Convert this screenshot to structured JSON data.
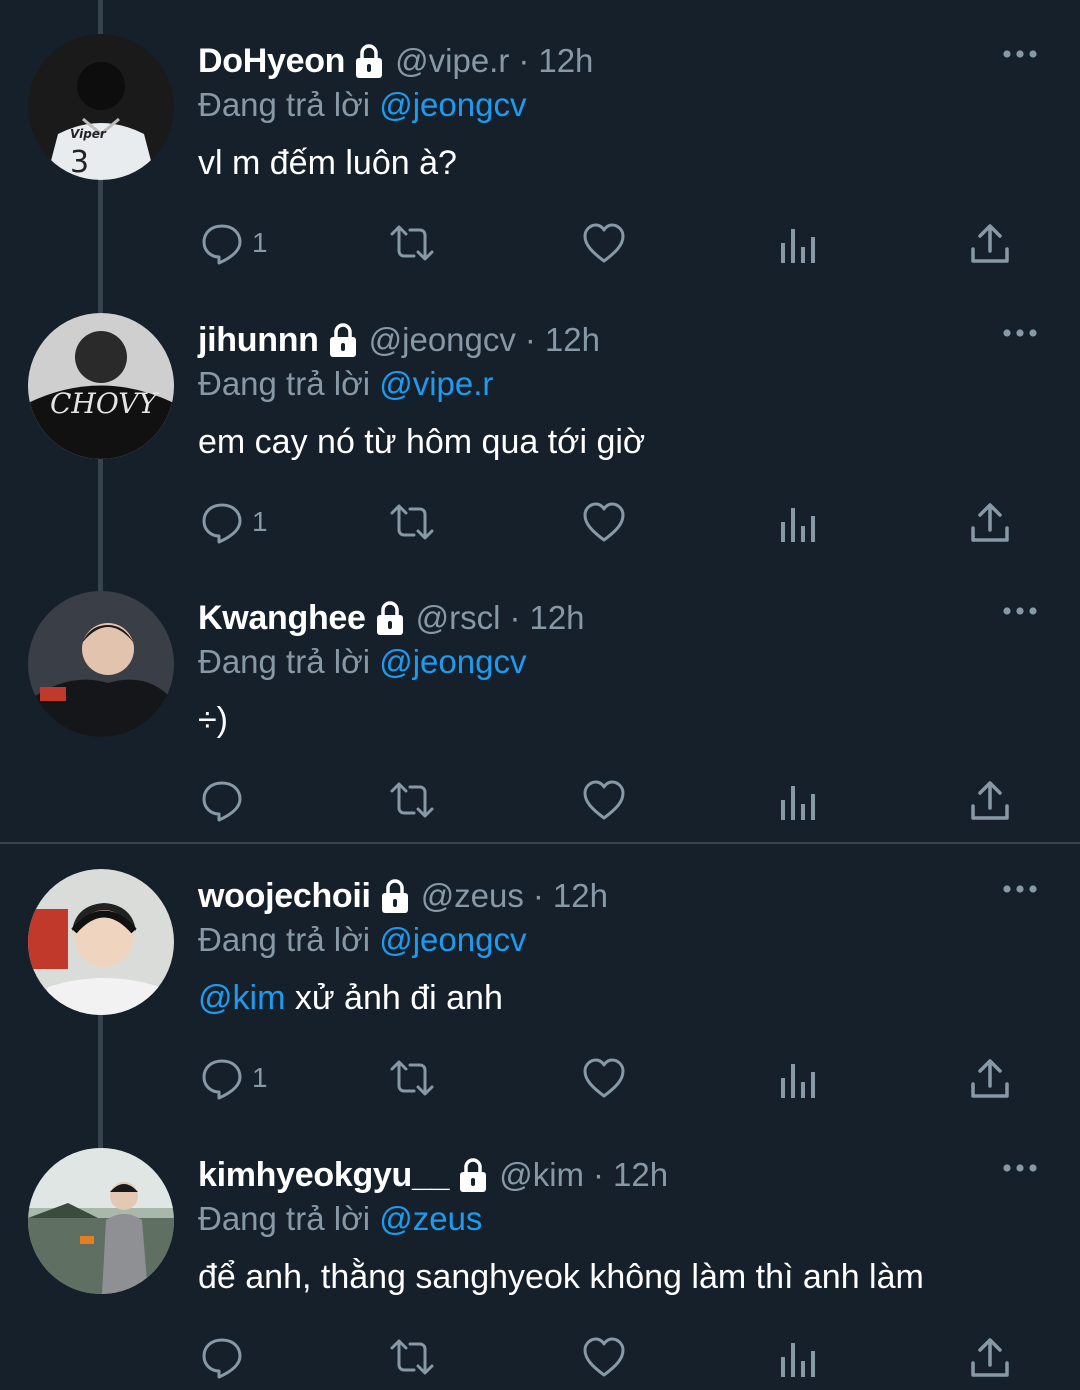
{
  "theme": {
    "background": "#15202b",
    "text": "#ffffff",
    "muted": "#8899a6",
    "accent": "#1d9bf0",
    "line": "#38444d"
  },
  "replying_prefix": "Đang trả lời",
  "tweets": [
    {
      "name": "DoHyeon",
      "handle": "@vipe.r",
      "time": "12h",
      "replying_to": "@jeongcv",
      "mention": "",
      "text": "vl m đếm luôn à?",
      "reply_count": "1",
      "avatar_text": "Viper"
    },
    {
      "name": "jihunnn",
      "handle": "@jeongcv",
      "time": "12h",
      "replying_to": "@vipe.r",
      "mention": "",
      "text": "em cay nó từ hôm qua tới giờ",
      "reply_count": "1",
      "avatar_text": "CHOVY"
    },
    {
      "name": "Kwanghee",
      "handle": "@rscl",
      "time": "12h",
      "replying_to": "@jeongcv",
      "mention": "",
      "text": "÷)",
      "reply_count": "",
      "avatar_text": ""
    },
    {
      "name": "woojechoii",
      "handle": "@zeus",
      "time": "12h",
      "replying_to": "@jeongcv",
      "mention": "@kim",
      "text": " xử ảnh đi anh",
      "reply_count": "1",
      "avatar_text": ""
    },
    {
      "name": "kimhyeokgyu__",
      "handle": "@kim",
      "time": "12h",
      "replying_to": "@zeus",
      "mention": "",
      "text": "để anh, thằng sanghyeok không làm thì anh làm",
      "reply_count": "",
      "avatar_text": ""
    }
  ],
  "icons": {
    "reply": "reply-icon",
    "retweet": "retweet-icon",
    "like": "heart-icon",
    "views": "analytics-icon",
    "share": "share-icon",
    "more": "more-icon",
    "lock": "lock-icon"
  }
}
